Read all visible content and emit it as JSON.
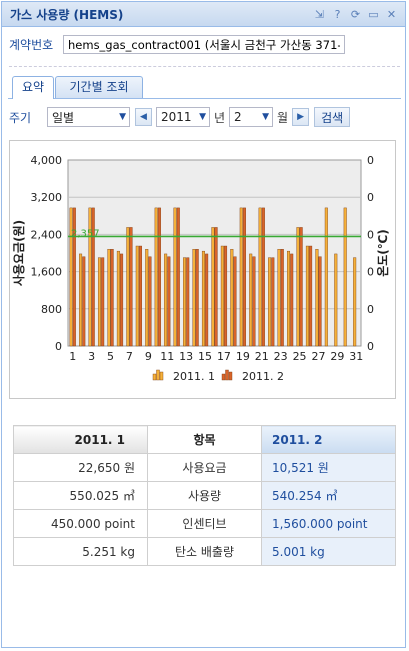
{
  "window": {
    "title": "가스 사용량 (HEMS)",
    "tools": [
      "⇲",
      "?",
      "⟳",
      "▭",
      "✕"
    ]
  },
  "contract": {
    "label": "계약번호",
    "value": "hems_gas_contract001 (서울시 금천구 가산동 371-"
  },
  "tabs": [
    {
      "label": "요약",
      "active": true
    },
    {
      "label": "기간별 조회",
      "active": false
    }
  ],
  "toolbar": {
    "period_label": "주기",
    "period_value": "일별",
    "year_value": "2011",
    "year_unit": "년",
    "month_value": "2",
    "month_unit": "월",
    "prev_icon": "chevron-left-icon",
    "next_icon": "chevron-right-icon",
    "search_label": "검색"
  },
  "chart_data": {
    "type": "bar",
    "categories": [
      "1",
      "2",
      "3",
      "4",
      "5",
      "6",
      "7",
      "8",
      "9",
      "10",
      "11",
      "12",
      "13",
      "14",
      "15",
      "16",
      "17",
      "18",
      "19",
      "20",
      "21",
      "22",
      "23",
      "24",
      "25",
      "26",
      "27",
      "28",
      "29",
      "30",
      "31"
    ],
    "x_tick_labels": [
      "1",
      "3",
      "5",
      "7",
      "9",
      "11",
      "13",
      "15",
      "17",
      "19",
      "21",
      "23",
      "25",
      "27",
      "29",
      "31"
    ],
    "series": [
      {
        "name": "2011. 1",
        "color": "#f5b13a",
        "values": [
          2970,
          1980,
          2970,
          1900,
          2080,
          2040,
          2550,
          2150,
          2080,
          2970,
          1980,
          2970,
          1900,
          2080,
          2040,
          2550,
          2150,
          2080,
          2970,
          1980,
          2970,
          1900,
          2080,
          2040,
          2550,
          2150,
          2080,
          2970,
          1980,
          2970,
          1900
        ]
      },
      {
        "name": "2011. 2",
        "color": "#d9642a",
        "values": [
          2970,
          1920,
          2970,
          1900,
          2080,
          1980,
          2550,
          2150,
          1920,
          2970,
          1920,
          2970,
          1900,
          2080,
          1980,
          2550,
          2150,
          1920,
          2970,
          1920,
          2970,
          1900,
          2080,
          1980,
          2550,
          2150,
          1920,
          null,
          null,
          null,
          null
        ]
      }
    ],
    "reference_line": {
      "label": "2,357",
      "value": 2357,
      "color": "#39a935"
    },
    "ylabel_left": "사용요금(원)",
    "ylabel_right": "온도(℃)",
    "ylim": [
      0,
      4000
    ],
    "y_ticks": [
      "0",
      "800",
      "1,600",
      "2,400",
      "3,200",
      "4,000"
    ],
    "y2_ticks": [
      "0",
      "0",
      "0",
      "0",
      "0",
      "0"
    ],
    "legend_position": "bottom",
    "grid": true
  },
  "summary": {
    "headers": [
      "2011. 1",
      "항목",
      "2011. 2"
    ],
    "rows": [
      {
        "left": "22,650 원",
        "item": "사용요금",
        "right": "10,521 원"
      },
      {
        "left": "550.025 ㎥",
        "item": "사용량",
        "right": "540.254 ㎥"
      },
      {
        "left": "450.000 point",
        "item": "인센티브",
        "right": "1,560.000 point"
      },
      {
        "left": "5.251 kg",
        "item": "탄소 배출량",
        "right": "5.001 kg"
      }
    ]
  }
}
